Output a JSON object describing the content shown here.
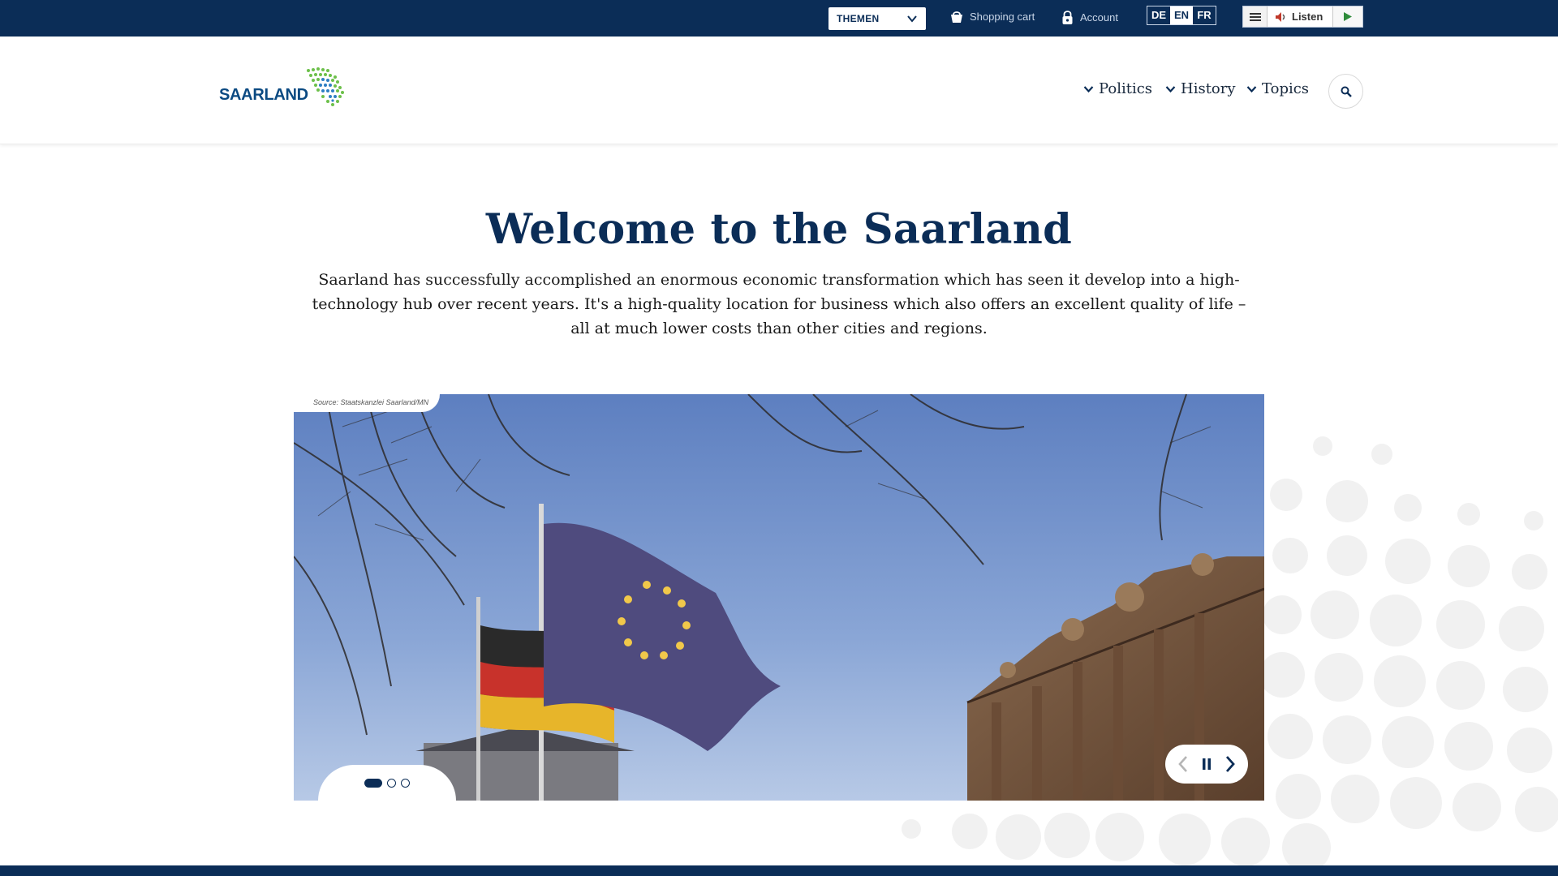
{
  "topbar": {
    "themen_label": "THEMEN",
    "cart_label": "Shopping cart",
    "account_label": "Account",
    "languages": [
      "DE",
      "EN",
      "FR"
    ],
    "active_language": "EN",
    "listen_label": "Listen"
  },
  "header": {
    "logo_text": "SAARLAND",
    "nav": [
      "Politics",
      "History",
      "Topics"
    ]
  },
  "main": {
    "title": "Welcome to the Saarland",
    "intro": "Saarland has successfully accomplished an enormous economic transformation which has seen it develop into a high-technology hub over recent years. It's a high-quality location for business which also offers an excellent quality of life – all at much lower costs than other cities and regions."
  },
  "slider": {
    "source": "Source: Staatskanzlei Saarland/MN",
    "slide_count": 3,
    "active_slide": 1
  },
  "colors": {
    "brand": "#0b2d57",
    "logo_blue": "#0b4a82",
    "logo_green": "#6cc04a"
  }
}
